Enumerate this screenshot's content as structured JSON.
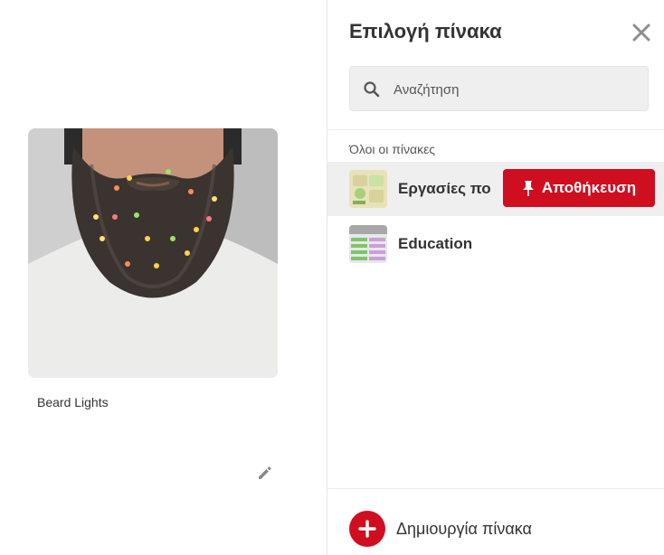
{
  "pin": {
    "caption": "Beard Lights"
  },
  "panel": {
    "title": "Επιλογή πίνακα",
    "search_placeholder": "Αναζήτηση",
    "section_label": "Όλοι οι πίνακες",
    "boards": [
      {
        "name": "Εργασίες πο",
        "thumb_icon": "board-thumbnail-worksheets"
      },
      {
        "name": "Education",
        "thumb_icon": "board-thumbnail-education"
      }
    ],
    "save_label": "Αποθήκευση",
    "create_label": "Δημιουργία πίνακα"
  },
  "colors": {
    "accent": "#cf0e20",
    "hover_row": "#efefef",
    "text": "#333333"
  },
  "icons": [
    "search-icon",
    "close-icon",
    "pin-icon",
    "plus-icon",
    "pencil-icon"
  ]
}
